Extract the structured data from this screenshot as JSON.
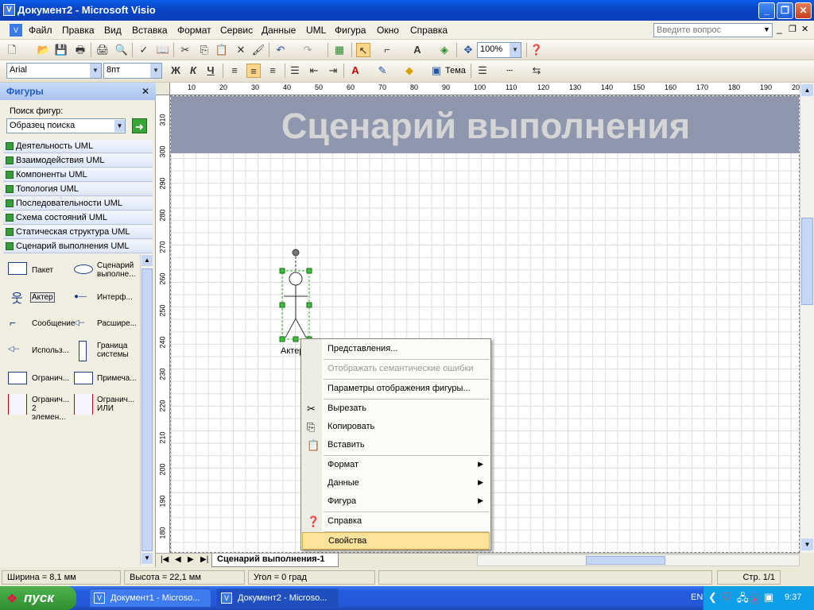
{
  "window": {
    "title": "Документ2 - Microsoft Visio"
  },
  "menu": [
    "Файл",
    "Правка",
    "Вид",
    "Вставка",
    "Формат",
    "Сервис",
    "Данные",
    "UML",
    "Фигура",
    "Окно",
    "Справка"
  ],
  "ask_placeholder": "Введите вопрос",
  "toolbar": {
    "zoom": "100%"
  },
  "format_toolbar": {
    "font": "Arial",
    "size": "8пт",
    "bold": "Ж",
    "italic": "К",
    "underline": "Ч",
    "theme": "Тема"
  },
  "shapes_panel": {
    "title": "Фигуры",
    "search_label": "Поиск фигур:",
    "search_placeholder": "Образец поиска",
    "stencils": [
      "Деятельность UML",
      "Взаимодействия UML",
      "Компоненты UML",
      "Топология UML",
      "Последовательности UML",
      "Схема состояний UML",
      "Статическая структура UML",
      "Сценарий выполнения UML"
    ],
    "masters": [
      {
        "label": "Пакет",
        "icon": "folder-icon"
      },
      {
        "label": "Сценарий выполне...",
        "icon": "ellipse-icon"
      },
      {
        "label": "Актер",
        "icon": "actor-icon"
      },
      {
        "label": "Интерф...",
        "icon": "interface-icon"
      },
      {
        "label": "Сообщение",
        "icon": "message-icon"
      },
      {
        "label": "Расшире...",
        "icon": "extend-icon"
      },
      {
        "label": "Использ...",
        "icon": "uses-icon"
      },
      {
        "label": "Граница системы",
        "icon": "system-boundary-icon"
      },
      {
        "label": "Огранич...",
        "icon": "constraint-icon"
      },
      {
        "label": "Примеча...",
        "icon": "note-icon"
      },
      {
        "label": "Огранич... 2 элемен...",
        "icon": "constraint-2-icon"
      },
      {
        "label": "Огранич... ИЛИ",
        "icon": "constraint-or-icon"
      }
    ]
  },
  "ruler": {
    "h_ticks": [
      "10",
      "20",
      "30",
      "40",
      "50",
      "60",
      "70",
      "80",
      "90",
      "100",
      "110",
      "120",
      "130",
      "140",
      "150",
      "160",
      "170",
      "180",
      "190",
      "20"
    ],
    "v_ticks": [
      "310",
      "300",
      "290",
      "280",
      "270",
      "260",
      "250",
      "240",
      "230",
      "220",
      "210",
      "200",
      "190",
      "180"
    ]
  },
  "page": {
    "banner": "Сценарий выполнения",
    "actor_label": "Актер"
  },
  "context_menu": [
    {
      "label": "Представления...",
      "enabled": true
    },
    {
      "label": "Отображать семантические ошибки",
      "enabled": false
    },
    {
      "label": "Параметры отображения фигуры...",
      "enabled": true
    },
    {
      "label": "Вырезать",
      "icon": "scissors-icon",
      "enabled": true
    },
    {
      "label": "Копировать",
      "icon": "copy-icon",
      "enabled": true
    },
    {
      "label": "Вставить",
      "icon": "paste-icon",
      "enabled": true
    },
    {
      "label": "Формат",
      "submenu": true,
      "enabled": true
    },
    {
      "label": "Данные",
      "submenu": true,
      "enabled": true
    },
    {
      "label": "Фигура",
      "submenu": true,
      "enabled": true
    },
    {
      "label": "Справка",
      "icon": "help-icon",
      "enabled": true
    },
    {
      "label": "Свойства",
      "enabled": true,
      "highlighted": true
    }
  ],
  "page_tab": "Сценарий выполнения-1",
  "status": {
    "width": "Ширина = 8,1 мм",
    "height": "Высота = 22,1 мм",
    "angle": "Угол = 0 град",
    "page": "Стр. 1/1"
  },
  "taskbar": {
    "start": "пуск",
    "tasks": [
      "Документ1 - Microso...",
      "Документ2 - Microso..."
    ],
    "lang": "EN",
    "clock": "9:37"
  }
}
